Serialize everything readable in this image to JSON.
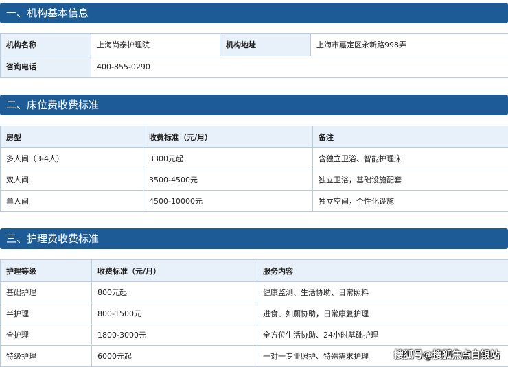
{
  "section1": {
    "title": "一、机构基本信息",
    "name_label": "机构名称",
    "name_value": "上海尚泰护理院",
    "address_label": "机构地址",
    "address_value": "上海市嘉定区永新路998弄",
    "phone_label": "咨询电话",
    "phone_value": "400-855-0290"
  },
  "section2": {
    "title": "二、床位费收费标准",
    "headers": [
      "房型",
      "收费标准（元/月）",
      "备注"
    ],
    "rows": [
      [
        "多人间（3-4人）",
        "3300元起",
        "含独立卫浴、智能护理床"
      ],
      [
        "双人间",
        "3500-4500元",
        "独立卫浴，基础设施配套"
      ],
      [
        "单人间",
        "4500-10000元",
        "独立空间，个性化设施"
      ]
    ]
  },
  "section3": {
    "title": "三、护理费收费标准",
    "headers": [
      "护理等级",
      "收费标准（元/月）",
      "服务内容"
    ],
    "rows": [
      [
        "基础护理",
        "800元起",
        "健康监测、生活协助、日常照料"
      ],
      [
        "半护理",
        "800-1500元",
        "进食、如厕协助，日常康复护理"
      ],
      [
        "全护理",
        "1800-3000元",
        "全方位生活协助、24小时基础护理"
      ],
      [
        "特级护理",
        "6000元起",
        "一对一专业照护、特殊需求护理"
      ]
    ]
  },
  "watermark": "搜狐号@搜狐焦点白银站"
}
